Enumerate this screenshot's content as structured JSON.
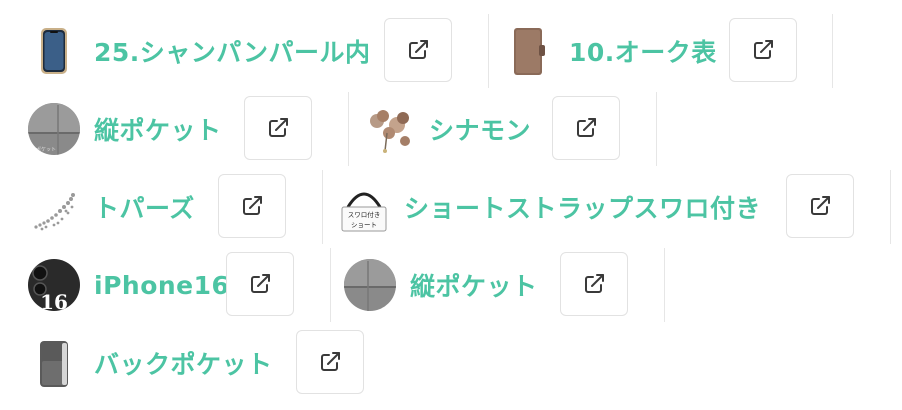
{
  "colors": {
    "accent": "#4cc4a3",
    "border": "#e2e2e2"
  },
  "icons": {
    "external": "external-link-icon"
  },
  "options": [
    {
      "label": "25.シャンパンパール内",
      "thumb": "iphone-case-thumbnail"
    },
    {
      "label": "10.オーク表",
      "thumb": "brown-case-thumbnail"
    },
    {
      "label": "縦ポケット",
      "thumb": "pocket-thumbnail"
    },
    {
      "label": "シナモン",
      "thumb": "flower-charm-thumbnail"
    },
    {
      "label": "トパーズ",
      "thumb": "beads-thumbnail"
    },
    {
      "label": "ショートストラップスワロ付き",
      "thumb": "short-strap-thumbnail",
      "thumb_text": [
        "スワロ付き",
        "ショート"
      ]
    },
    {
      "label": "iPhone16",
      "thumb": "iphone16-thumbnail",
      "thumb_text": "16"
    },
    {
      "label": "縦ポケット",
      "thumb": "pocket-thumbnail"
    },
    {
      "label": "バックポケット",
      "thumb": "back-pocket-thumbnail"
    }
  ]
}
